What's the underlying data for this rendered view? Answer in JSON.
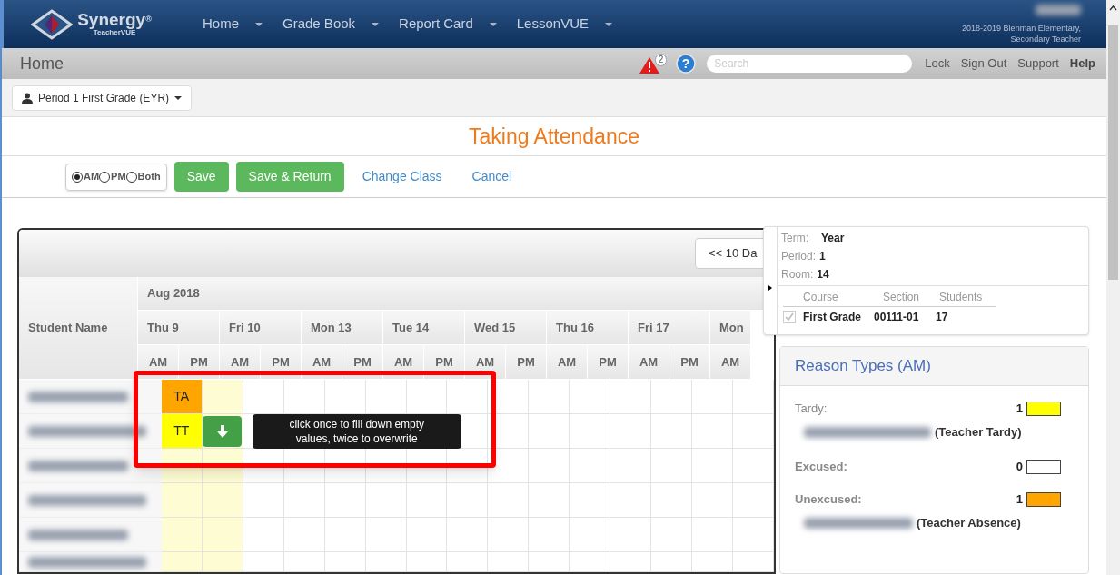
{
  "nav": {
    "logo": {
      "name": "Synergy",
      "mark": "®",
      "subtitle": "TeacherVUE"
    },
    "menus": [
      "Home",
      "Grade Book",
      "Report Card",
      "LessonVUE"
    ],
    "school": [
      "2018-2019 Blenman Elementary,",
      "Secondary Teacher"
    ]
  },
  "header": {
    "title": "Home",
    "alert_count": "2",
    "help_glyph": "?",
    "search": {
      "placeholder": "Search"
    },
    "links": [
      "Lock",
      "Sign Out",
      "Support",
      "Help"
    ]
  },
  "class_selector": "Period 1 First Grade (EYR)",
  "page_title": "Taking Attendance",
  "toolbar": {
    "session_options": [
      {
        "label": "AM",
        "selected": true
      },
      {
        "label": "PM",
        "selected": false
      },
      {
        "label": "Both",
        "selected": false
      }
    ],
    "buttons": [
      "Save",
      "Save & Return"
    ],
    "links": [
      "Change Class",
      "Cancel"
    ]
  },
  "grid": {
    "nav_button": "<< 10 Da",
    "student_header": "Student Name",
    "month": "Aug 2018",
    "days": [
      {
        "label": "Thu 9",
        "selected": true,
        "sessions": [
          "AM",
          "PM"
        ]
      },
      {
        "label": "Fri 10",
        "selected": false,
        "sessions": [
          "AM",
          "PM"
        ]
      },
      {
        "label": "Mon 13",
        "selected": false,
        "sessions": [
          "AM",
          "PM"
        ]
      },
      {
        "label": "Tue 14",
        "selected": false,
        "sessions": [
          "AM",
          "PM"
        ]
      },
      {
        "label": "Wed 15",
        "selected": false,
        "sessions": [
          "AM",
          "PM"
        ]
      },
      {
        "label": "Thu 16",
        "selected": false,
        "sessions": [
          "AM",
          "PM"
        ]
      },
      {
        "label": "Fri 17",
        "selected": false,
        "sessions": [
          "AM",
          "PM"
        ]
      },
      {
        "label": "Mon",
        "selected": false,
        "sessions": [
          "AM"
        ]
      }
    ],
    "rows": [
      {
        "cells": [
          {
            "kind": "mark",
            "code": "TA",
            "color": "#ffa500"
          }
        ]
      },
      {
        "cells": [
          {
            "kind": "mark",
            "code": "TT",
            "color": "#ffff00"
          },
          {
            "kind": "fill-down",
            "tooltip": "click once to fill down empty values, twice to overwrite"
          }
        ]
      },
      {},
      {},
      {},
      {}
    ]
  },
  "class_info": {
    "fields": [
      {
        "label": "Term:",
        "value": "Year"
      },
      {
        "label": "Period:",
        "value": "1"
      },
      {
        "label": "Room:",
        "value": "14"
      }
    ],
    "columns": [
      "Course",
      "Section",
      "Students"
    ],
    "rows": [
      {
        "checked": true,
        "course": "First Grade",
        "section": "00111-01",
        "students": "17"
      }
    ]
  },
  "reasons": {
    "title": "Reason Types (AM)",
    "items": [
      {
        "label": "Tardy:",
        "count": "1",
        "color": "#ffff00",
        "students": [
          {
            "reason": "(Teacher Tardy)"
          }
        ]
      },
      {
        "label": "Excused:",
        "count": "0",
        "color": "#ffffff"
      },
      {
        "label": "Unexcused:",
        "count": "1",
        "color": "#ffa500",
        "students": [
          {
            "reason": "(Teacher Absence)"
          }
        ]
      }
    ]
  }
}
